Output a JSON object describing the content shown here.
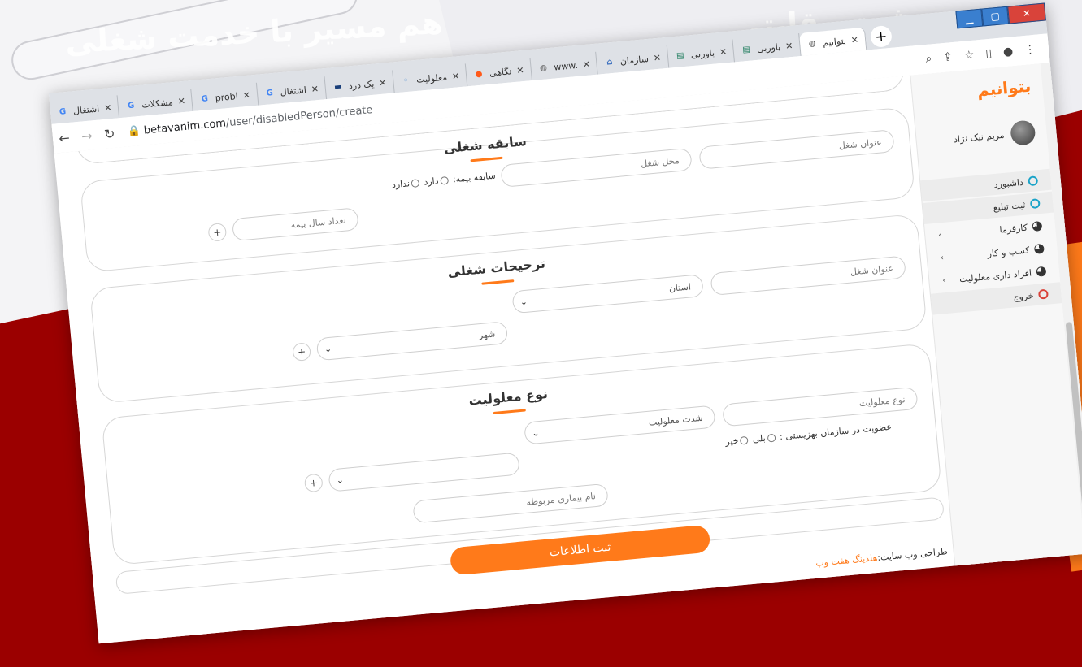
{
  "hero": {
    "line1": "ثبت رقابتی",
    "line2": "هم مسیر با خدمت شغلی"
  },
  "browser": {
    "tabs": [
      {
        "label": "اشتغال",
        "icon": "google-icon",
        "active": false
      },
      {
        "label": "مشکلات",
        "icon": "google-icon",
        "active": false
      },
      {
        "label": "probl",
        "icon": "google-icon",
        "active": false
      },
      {
        "label": "اشتغال",
        "icon": "google-icon",
        "active": false
      },
      {
        "label": "یک درد",
        "icon": "film-icon",
        "active": false
      },
      {
        "label": "معلولیت",
        "icon": "generic-icon",
        "active": false
      },
      {
        "label": "نگاهی",
        "icon": "orange-logo-icon",
        "active": false
      },
      {
        "label": "www.",
        "icon": "globe-icon",
        "active": false
      },
      {
        "label": "سازمان",
        "icon": "building-icon",
        "active": false
      },
      {
        "label": "باوربی",
        "icon": "doc-icon",
        "active": false
      },
      {
        "label": "باوربی",
        "icon": "doc-icon",
        "active": false
      },
      {
        "label": "بتوانیم",
        "icon": "globe-icon",
        "active": true
      }
    ],
    "url_host": "betavanim.com",
    "url_path": "/user/disabledPerson/create",
    "close_mark": "✕",
    "newtab": "+"
  },
  "sidebar": {
    "brand": "بتوانیم",
    "user_name": "مریم نیک نژاد",
    "items": [
      {
        "label": "داشبورد",
        "icon": "circle-icon"
      },
      {
        "label": "ثبت تبلیغ",
        "icon": "circle-icon"
      },
      {
        "label": "کارفرما",
        "icon": "pie-icon"
      },
      {
        "label": "کسب و کار",
        "icon": "pie-icon"
      },
      {
        "label": "افراد داری معلولیت",
        "icon": "pie-icon"
      },
      {
        "label": "خروج",
        "icon": "circle-icon"
      }
    ]
  },
  "form": {
    "work_history": {
      "title": "سابقه شغلی",
      "job_title_placeholder": "عنوان شغل",
      "job_location_placeholder": "محل شغل",
      "insurance_label": "سابقه بیمه:",
      "has": "دارد",
      "has_not": "ندارد",
      "insurance_years_placeholder": "تعداد سال بیمه"
    },
    "job_preferences": {
      "title": "ترجیحات شغلی",
      "job_title_placeholder": "عنوان شغل",
      "province": "استان",
      "city": "شهر"
    },
    "disability": {
      "title": "نوع معلولیت",
      "type_placeholder": "نوع معلولیت",
      "severity": "شدت معلولیت",
      "welfare_label": "عضویت در سازمان بهزیستی :",
      "yes": "بلی",
      "no": "خیر",
      "disease_placeholder": "نام بیماری مربوطه"
    },
    "submit": "ثبت اطلاعات",
    "plus": "+"
  },
  "footer": {
    "prefix": "طراحی وب سایت:",
    "link": "هلدینگ هفت وب"
  },
  "colors": {
    "accent": "#ff7a1a",
    "backdrop": "#9b0000"
  }
}
